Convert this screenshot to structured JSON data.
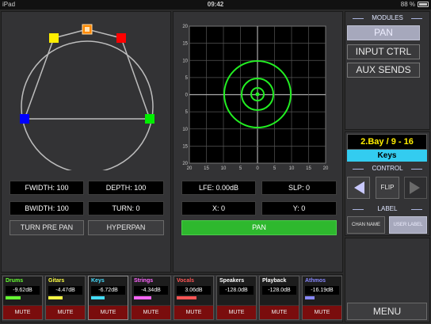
{
  "status_bar": {
    "device": "iPad",
    "time": "09:42",
    "battery": "88 %"
  },
  "pan_panel": {
    "fwidth": "FWIDTH: 100",
    "depth": "DEPTH: 100",
    "bwidth": "BWIDTH: 100",
    "turn": "TURN: 0",
    "turn_pre_pan": "TURN PRE PAN",
    "hyperpan": "HYPERPAN"
  },
  "xy_panel": {
    "lfe": "LFE: 0.00dB",
    "slp": "SLP: 0",
    "x": "X: 0",
    "y": "Y: 0",
    "pan_button": "PAN",
    "left_ticks": [
      "20",
      "15",
      "10",
      "5",
      "0",
      "5",
      "10",
      "15",
      "20"
    ],
    "bottom_ticks": [
      "20",
      "15",
      "10",
      "5",
      "0",
      "5",
      "10",
      "15",
      "20"
    ]
  },
  "modules": {
    "title": "MODULES",
    "items": [
      "PAN",
      "INPUT CTRL",
      "AUX SENDS"
    ],
    "active_index": 0
  },
  "bay": {
    "name": "2.Bay / 9 - 16",
    "channel": "Keys"
  },
  "control": {
    "title": "CONTROL",
    "flip": "FLIP"
  },
  "label": {
    "title": "LABEL",
    "chan_name": "CHAN NAME",
    "user_label": "USER LABEL"
  },
  "menu": "MENU",
  "channels": [
    {
      "name": "Drums",
      "value": "-9.62dB",
      "mute": "MUTE",
      "color": "#66ff33"
    },
    {
      "name": "Gitars",
      "value": "-4.47dB",
      "mute": "MUTE",
      "color": "#ffff44"
    },
    {
      "name": "Keys",
      "value": "-6.72dB",
      "mute": "MUTE",
      "color": "#44ddff"
    },
    {
      "name": "Strings",
      "value": "-4.34dB",
      "mute": "MUTE",
      "color": "#ff66ff"
    },
    {
      "name": "Vocals",
      "value": "3.06dB",
      "mute": "MUTE",
      "color": "#ff5555"
    },
    {
      "name": "Speakers",
      "value": "-128.0dB",
      "mute": "MUTE",
      "color": "#ffffff"
    },
    {
      "name": "Playback",
      "value": "-128.0dB",
      "mute": "MUTE",
      "color": "#ffffff"
    },
    {
      "name": "Athmos",
      "value": "-16.19dB",
      "mute": "MUTE",
      "color": "#8888ff"
    }
  ],
  "speaker_colors": [
    "#ffee00",
    "#ff8800",
    "#ff0000",
    "#00ee00",
    "#0000ff"
  ]
}
